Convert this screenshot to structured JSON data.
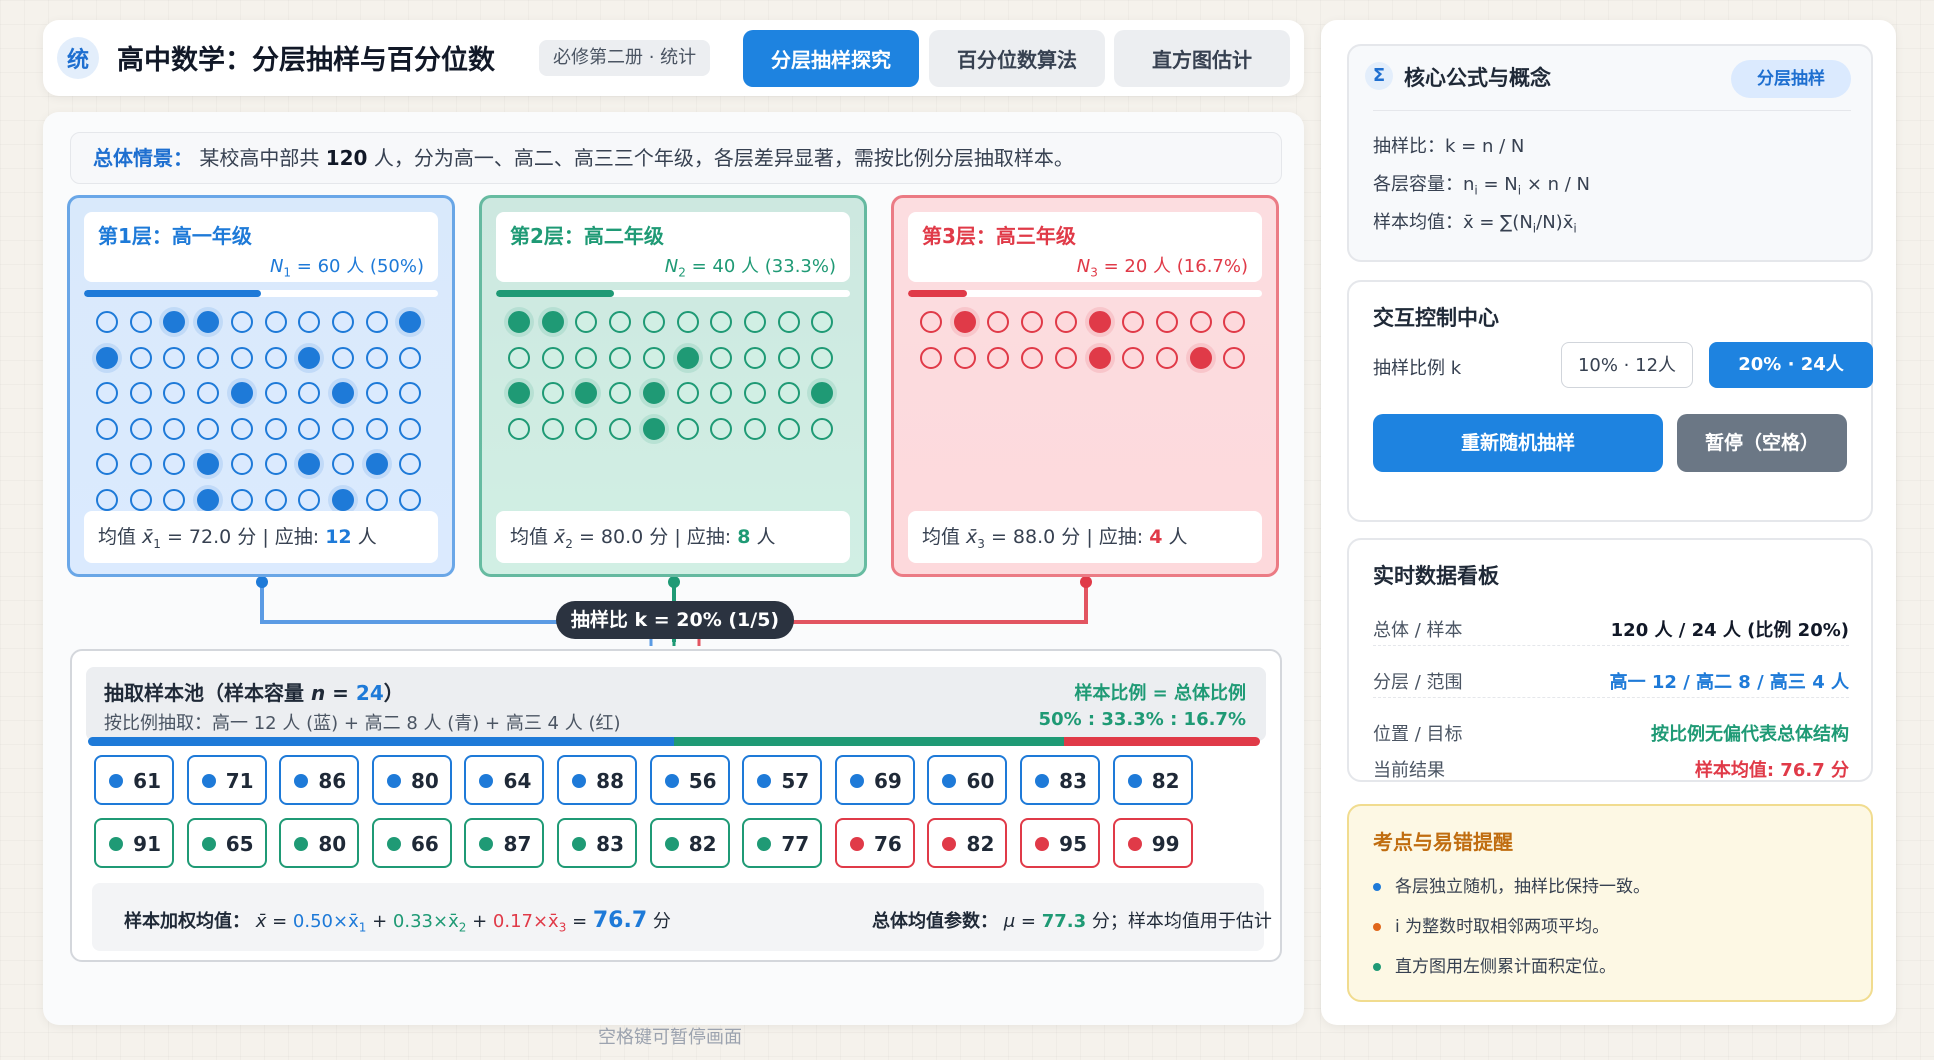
{
  "header": {
    "logo": "统",
    "title": "高中数学：分层抽样与百分位数",
    "edition": "必修第二册 · 统计",
    "tabs": [
      {
        "label": "分层抽样探究",
        "active": true
      },
      {
        "label": "百分位数算法",
        "active": false
      },
      {
        "label": "直方图估计",
        "active": false
      }
    ]
  },
  "scenario": {
    "label": "总体情景：",
    "text_a": "某校高中部共 ",
    "total": "120",
    "text_b": " 人，分为高一、高二、高三三个年级，各层差异显著，需按比例分层抽取样本。"
  },
  "layers": [
    {
      "title": "第1层：高一年级",
      "count_var": "N",
      "count_sub": "1",
      "count_text": " = 60 人 (50%)",
      "color": "#1e7ad8",
      "light": "#dbeafe",
      "bg": "#d9e9fb",
      "bar_pct": 0.5,
      "mean_label": "均值 ",
      "mean_sub": "1",
      "mean_text": " = 72.0 分 | 应抽: ",
      "draw": "12",
      "draw_unit": " 人",
      "rows": 6,
      "filled": [
        [
          2,
          3,
          9
        ],
        [
          0,
          6
        ],
        [
          4,
          7
        ],
        [],
        [
          3,
          6,
          8
        ],
        [
          3,
          7
        ]
      ]
    },
    {
      "title": "第2层：高二年级",
      "count_var": "N",
      "count_sub": "2",
      "count_text": " = 40 人 (33.3%)",
      "color": "#1f9a75",
      "light": "#d1efe4",
      "bg": "#cde8e0",
      "bar_pct": 0.333,
      "mean_label": "均值 ",
      "mean_sub": "2",
      "mean_text": " = 80.0 分 | 应抽: ",
      "draw": "8",
      "draw_unit": " 人",
      "rows": 4,
      "filled": [
        [
          0,
          1
        ],
        [
          5
        ],
        [
          0,
          2,
          4,
          9
        ],
        [
          4
        ]
      ]
    },
    {
      "title": "第3层：高三年级",
      "count_var": "N",
      "count_sub": "3",
      "count_text": " = 20 人 (16.7%)",
      "color": "#e03a48",
      "light": "#fdd9dc",
      "bg": "#fcdde0",
      "bar_pct": 0.167,
      "mean_label": "均值 ",
      "mean_sub": "3",
      "mean_text": " = 88.0 分 | 应抽: ",
      "draw": "4",
      "draw_unit": " 人",
      "rows": 2,
      "filled": [
        [
          1,
          5
        ],
        [
          5,
          8
        ]
      ]
    }
  ],
  "ratio_pill": "抽样比 k = 20% (1/5)",
  "pool": {
    "title_a": "抽取样本池（样本容量 ",
    "title_n": "n",
    "title_eq": " = ",
    "title_val": "24",
    "title_b": "）",
    "sub": "按比例抽取：高一 12 人 (蓝) + 高二 8 人 (青) + 高三 4 人 (红)",
    "right1": "样本比例 = 总体比例",
    "right2": "50% : 33.3% : 16.7%",
    "row1": [
      {
        "v": "61",
        "c": "b"
      },
      {
        "v": "71",
        "c": "b"
      },
      {
        "v": "86",
        "c": "b"
      },
      {
        "v": "80",
        "c": "b"
      },
      {
        "v": "64",
        "c": "b"
      },
      {
        "v": "88",
        "c": "b"
      },
      {
        "v": "56",
        "c": "b"
      },
      {
        "v": "57",
        "c": "b"
      },
      {
        "v": "69",
        "c": "b"
      },
      {
        "v": "60",
        "c": "b"
      },
      {
        "v": "83",
        "c": "b"
      },
      {
        "v": "82",
        "c": "b"
      }
    ],
    "row2": [
      {
        "v": "91",
        "c": "g"
      },
      {
        "v": "65",
        "c": "g"
      },
      {
        "v": "80",
        "c": "g"
      },
      {
        "v": "66",
        "c": "g"
      },
      {
        "v": "87",
        "c": "g"
      },
      {
        "v": "83",
        "c": "g"
      },
      {
        "v": "82",
        "c": "g"
      },
      {
        "v": "77",
        "c": "g"
      },
      {
        "v": "76",
        "c": "r"
      },
      {
        "v": "82",
        "c": "r"
      },
      {
        "v": "95",
        "c": "r"
      },
      {
        "v": "99",
        "c": "r"
      }
    ],
    "weighted_label": "样本加权均值：",
    "weighted_x": "x̄",
    "weighted_eq": " = ",
    "w1": "0.50×x̄",
    "w1s": "1",
    "w2": "0.33×x̄",
    "w2s": "2",
    "w3": "0.17×x̄",
    "w3s": "3",
    "plus": " + ",
    "weighted_val": "76.7",
    "weighted_unit": " 分",
    "pop_label": "总体均值参数：",
    "pop_mu": "μ",
    "pop_eq": " = ",
    "pop_val": "77.3",
    "pop_rest": " 分；样本均值用于估计"
  },
  "hint": "空格键可暂停画面",
  "formula": {
    "icon": "Σ",
    "title": "核心公式与概念",
    "tag": "分层抽样",
    "l1": "抽样比：k = n / N",
    "l2a": "各层容量：n",
    "l2s": "i",
    "l2b": " = N",
    "l2s2": "i",
    "l2c": " × n / N",
    "l3a": "样本均值：x̄ = ∑(N",
    "l3s": "i",
    "l3b": "/N)x̄",
    "l3s2": "i"
  },
  "controls": {
    "title": "交互控制中心",
    "k_label": "抽样比例 k",
    "k10": "10% · 12人",
    "k20": "20% · 24人",
    "resample": "重新随机抽样",
    "pause": "暂停（空格）"
  },
  "dashboard": {
    "title": "实时数据看板",
    "rows": [
      {
        "k": "总体 / 样本",
        "v": "120 人 / 24 人 (比例 20%)",
        "color": "#111827"
      },
      {
        "k": "分层 / 范围",
        "v": "高一 12 / 高二 8 / 高三 4 人",
        "color": "#1e7ad8"
      },
      {
        "k": "位置 / 目标",
        "v": "按比例无偏代表总体结构",
        "color": "#1f9a75"
      },
      {
        "k": "当前结果",
        "v": "样本均值: 76.7 分",
        "color": "#e03a48"
      }
    ]
  },
  "tips": {
    "title": "考点与易错提醒",
    "items": [
      {
        "text": "各层独立随机，抽样比保持一致。",
        "color": "#1e7ad8"
      },
      {
        "text": "i 为整数时取相邻两项平均。",
        "color": "#e0661a"
      },
      {
        "text": "直方图用左侧累计面积定位。",
        "color": "#1f9a75"
      }
    ]
  },
  "colors": {
    "blue": "#1e7ad8",
    "green": "#1f9a75",
    "red": "#e03a48",
    "accent": "#1e83e0"
  }
}
